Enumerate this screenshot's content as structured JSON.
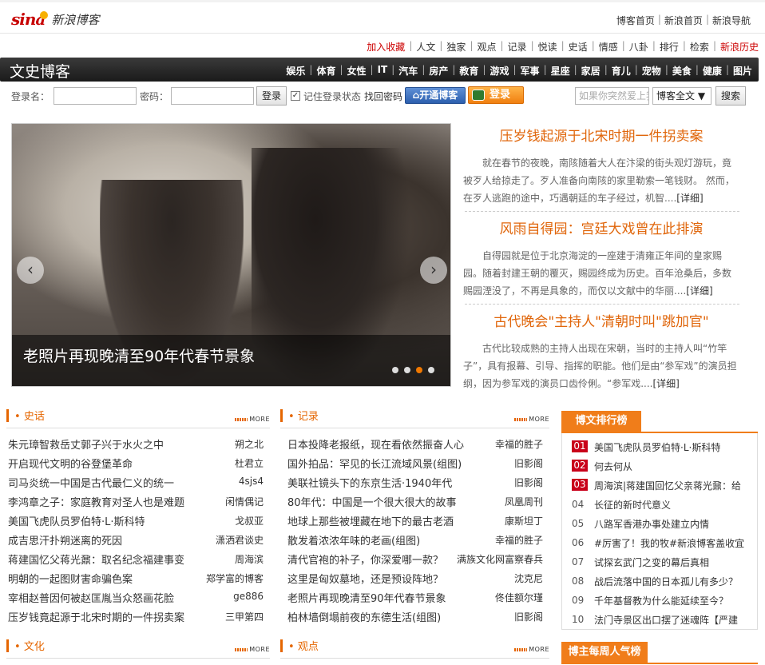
{
  "header": {
    "logo_brand": "sina",
    "logo_text": "新浪博客",
    "links": [
      "博客首页",
      "新浪首页",
      "新浪导航"
    ]
  },
  "subnav": {
    "items": [
      "加入收藏",
      "人文",
      "独家",
      "观点",
      "记录",
      "悦读",
      "史话",
      "情感",
      "八卦",
      "排行",
      "检索",
      "新浪历史"
    ]
  },
  "channel": {
    "title": "文史博客",
    "nav": [
      "娱乐",
      "体育",
      "女性",
      "IT",
      "汽车",
      "房产",
      "教育",
      "游戏",
      "军事",
      "星座",
      "家居",
      "育儿",
      "宠物",
      "美食",
      "健康",
      "图片"
    ]
  },
  "login": {
    "username_label": "登录名：",
    "password_label": "密码：",
    "login_button": "登录",
    "remember_label": "记住登录状态",
    "forgot_link": "找回密码",
    "open_blog_button": "开通博客",
    "orange_login": "登录",
    "search_placeholder": "如果你突然爱上我",
    "search_scope": "博客全文 ▼",
    "search_button": "搜索"
  },
  "slideshow": {
    "caption": "老照片再现晚清至90年代春节景象",
    "prev_arrow": "‹",
    "next_arrow": "›",
    "active_dot": 3
  },
  "featured": [
    {
      "title": "压岁钱起源于北宋时期一件拐卖案",
      "summary": "就在春节的夜晚，南陔随着大人在汴梁的街头观灯游玩，竟被歹人给掠走了。歹人准备向南陔的家里勒索一笔钱财。 然而，在歹人逃跑的途中，巧遇朝廷的车子经过，机智....",
      "more": "[详细]"
    },
    {
      "title": "风雨自得园：宫廷大戏曾在此排演",
      "summary": "自得园就是位于北京海淀的一座建于清雍正年间的皇家赐园。随着封建王朝的覆灭，赐园终成为历史。百年沧桑后，多数赐园湮没了，不再是具象的，而仅以文献中的华丽....",
      "more": "[详细]"
    },
    {
      "title": "古代晚会\"主持人\"清朝时叫\"跳加官\"",
      "summary": "古代比较成熟的主持人出现在宋朝，当时的主持人叫“竹竿子”，具有报幕、引导、指挥的职能。他们是由“参军戏”的演员担纲，因为参军戏的演员口齿伶俐。“参军戏....",
      "more": "[详细]"
    }
  ],
  "sections": {
    "history": {
      "title": "史话",
      "more": "MORE",
      "items": [
        {
          "title": "朱元璋智救岳丈郭子兴于水火之中",
          "author": "朔之北"
        },
        {
          "title": "开启现代文明的谷登堡革命",
          "author": "杜君立"
        },
        {
          "title": "司马炎统一中国是古代最仁义的统一",
          "author": "4sjs4"
        },
        {
          "title": "李鸿章之子：家庭教育对圣人也是难题",
          "author": "闲情偶记"
        },
        {
          "title": "美国飞虎队员罗伯特·L·斯科特",
          "author": "戈叔亚"
        },
        {
          "title": "成吉思汗扑朔迷离的死因",
          "author": "潇洒君谈史"
        },
        {
          "title": "蒋建国忆父蒋光鼐：取名纪念福建事变",
          "author": "周海滨"
        },
        {
          "title": "明朝的一起图财害命骗色案",
          "author": "郑学富的博客"
        },
        {
          "title": "宰相赵普因何被赵匡胤当众怒画花脸",
          "author": "ge886"
        },
        {
          "title": "压岁钱竟起源于北宋时期的一件拐卖案",
          "author": "三甲第四"
        }
      ]
    },
    "records": {
      "title": "记录",
      "more": "MORE",
      "items": [
        {
          "title": "日本投降老报纸，现在看依然振奋人心",
          "author": "幸福的胜子"
        },
        {
          "title": "国外拍品：罕见的长江流域风景(组图)",
          "author": "旧影阁"
        },
        {
          "title": "美联社镜头下的东京生活·1940年代",
          "author": "旧影阁"
        },
        {
          "title": "80年代：中国是一个很大很大的故事",
          "author": "凤凰周刊"
        },
        {
          "title": "地球上那些被埋藏在地下的最古老酒",
          "author": "康斯坦丁"
        },
        {
          "title": "散发着浓浓年味的老画(组图)",
          "author": "幸福的胜子"
        },
        {
          "title": "清代官袍的补子，你深爱哪一款？",
          "author": "满族文化网富察春兵"
        },
        {
          "title": "这里是匈奴墓地，还是预设阵地？",
          "author": "沈克尼"
        },
        {
          "title": "老照片再现晚清至90年代春节景象",
          "author": "佟佳额尔瑾"
        },
        {
          "title": "柏林墙倒塌前夜的东德生活(组图)",
          "author": "旧影阁"
        }
      ]
    },
    "culture": {
      "title": "文化",
      "more": "MORE"
    },
    "opinion": {
      "title": "观点",
      "more": "MORE"
    }
  },
  "ranking": {
    "title": "博文排行榜",
    "items": [
      {
        "num": "01",
        "title": "美国飞虎队员罗伯特·L·斯科特"
      },
      {
        "num": "02",
        "title": "何去何从"
      },
      {
        "num": "03",
        "title": "周海滨|蒋建国回忆父亲蒋光鼐：给"
      },
      {
        "num": "04",
        "title": "长征的新时代意义"
      },
      {
        "num": "05",
        "title": "八路军香港办事处建立内情"
      },
      {
        "num": "06",
        "title": "#厉害了！我的牧#新浪博客盖收宜"
      },
      {
        "num": "07",
        "title": "试探玄武门之变的幕后真相"
      },
      {
        "num": "08",
        "title": "战后流落中国的日本孤儿有多少？"
      },
      {
        "num": "09",
        "title": "千年基督教为什么能延续至今？"
      },
      {
        "num": "10",
        "title": "法门寺景区出口摆了迷魂阵【严建"
      }
    ]
  },
  "popular": {
    "title": "博主每周人气榜"
  },
  "colors": {
    "accent": "#e56600",
    "hot_rank": "#c9001a",
    "brand_red": "#c70000"
  }
}
